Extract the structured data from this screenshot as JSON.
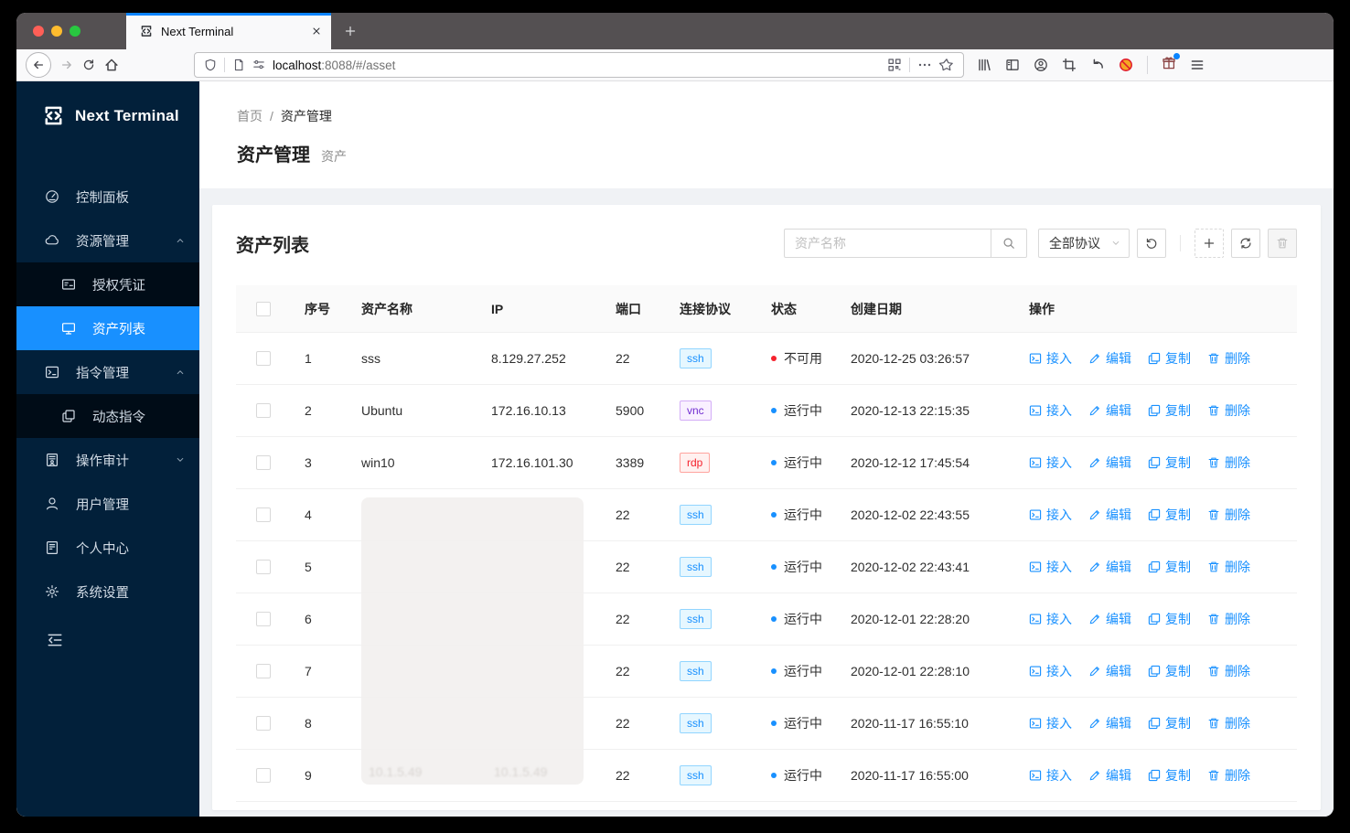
{
  "browser": {
    "tab_title": "Next Terminal",
    "url_host": "localhost",
    "url_rest": ":8088/#/asset"
  },
  "sidebar": {
    "logo_text": "Next Terminal",
    "items": [
      {
        "label": "控制面板",
        "icon": "dashboard-icon"
      },
      {
        "label": "资源管理",
        "icon": "cloud-icon",
        "chevron": "up"
      },
      {
        "label": "授权凭证",
        "icon": "idcard-icon",
        "child": true
      },
      {
        "label": "资产列表",
        "icon": "desktop-icon",
        "child": true,
        "active": true
      },
      {
        "label": "指令管理",
        "icon": "code-icon",
        "chevron": "up"
      },
      {
        "label": "动态指令",
        "icon": "block-icon",
        "child": true
      },
      {
        "label": "操作审计",
        "icon": "audit-icon",
        "chevron": "down"
      },
      {
        "label": "用户管理",
        "icon": "user-icon"
      },
      {
        "label": "个人中心",
        "icon": "profile-icon"
      },
      {
        "label": "系统设置",
        "icon": "setting-icon"
      }
    ]
  },
  "page": {
    "breadcrumb": [
      "首页",
      "资产管理"
    ],
    "breadcrumb_separator": "/",
    "title": "资产管理",
    "subtitle": "资产"
  },
  "card": {
    "title": "资产列表",
    "search_placeholder": "资产名称",
    "protocol_filter": "全部协议"
  },
  "table": {
    "columns": [
      "序号",
      "资产名称",
      "IP",
      "端口",
      "连接协议",
      "状态",
      "创建日期",
      "操作"
    ],
    "actions": [
      {
        "label": "接入",
        "icon": "terminal-icon"
      },
      {
        "label": "编辑",
        "icon": "edit-icon"
      },
      {
        "label": "复制",
        "icon": "copy-icon"
      },
      {
        "label": "删除",
        "icon": "delete-icon"
      }
    ],
    "redacted_text": "10.1.5.49",
    "rows": [
      {
        "index": "1",
        "name": "sss",
        "ip": "8.129.27.252",
        "port": "22",
        "protocol": "ssh",
        "status": "不可用",
        "status_type": "error",
        "date": "2020-12-25 03:26:57"
      },
      {
        "index": "2",
        "name": "Ubuntu",
        "ip": "172.16.10.13",
        "port": "5900",
        "protocol": "vnc",
        "status": "运行中",
        "status_type": "processing",
        "date": "2020-12-13 22:15:35"
      },
      {
        "index": "3",
        "name": "win10",
        "ip": "172.16.101.30",
        "port": "3389",
        "protocol": "rdp",
        "status": "运行中",
        "status_type": "processing",
        "date": "2020-12-12 17:45:54"
      },
      {
        "index": "4",
        "name": "",
        "ip": "",
        "redacted": true,
        "port": "22",
        "protocol": "ssh",
        "status": "运行中",
        "status_type": "processing",
        "date": "2020-12-02 22:43:55"
      },
      {
        "index": "5",
        "name": "",
        "ip": "",
        "redacted": true,
        "port": "22",
        "protocol": "ssh",
        "status": "运行中",
        "status_type": "processing",
        "date": "2020-12-02 22:43:41"
      },
      {
        "index": "6",
        "name": "",
        "ip": "",
        "redacted": true,
        "port": "22",
        "protocol": "ssh",
        "status": "运行中",
        "status_type": "processing",
        "date": "2020-12-01 22:28:20"
      },
      {
        "index": "7",
        "name": "",
        "ip": "",
        "redacted": true,
        "port": "22",
        "protocol": "ssh",
        "status": "运行中",
        "status_type": "processing",
        "date": "2020-12-01 22:28:10"
      },
      {
        "index": "8",
        "name": "",
        "ip": "",
        "redacted": true,
        "port": "22",
        "protocol": "ssh",
        "status": "运行中",
        "status_type": "processing",
        "date": "2020-11-17 16:55:10"
      },
      {
        "index": "9",
        "name": "",
        "ip": "",
        "redacted": true,
        "port": "22",
        "protocol": "ssh",
        "status": "运行中",
        "status_type": "processing",
        "date": "2020-11-17 16:55:00"
      }
    ]
  },
  "colors": {
    "accent": "#1890ff",
    "sidebar_bg": "#02203a",
    "sidebar_submenu_bg": "#000c17",
    "status_error": "#f5222d",
    "status_processing": "#1890ff",
    "tag_ssh": "#1890ff",
    "tag_vnc": "#722ed1",
    "tag_rdp": "#f5222d",
    "tab_top_line": "#0a84ff"
  }
}
